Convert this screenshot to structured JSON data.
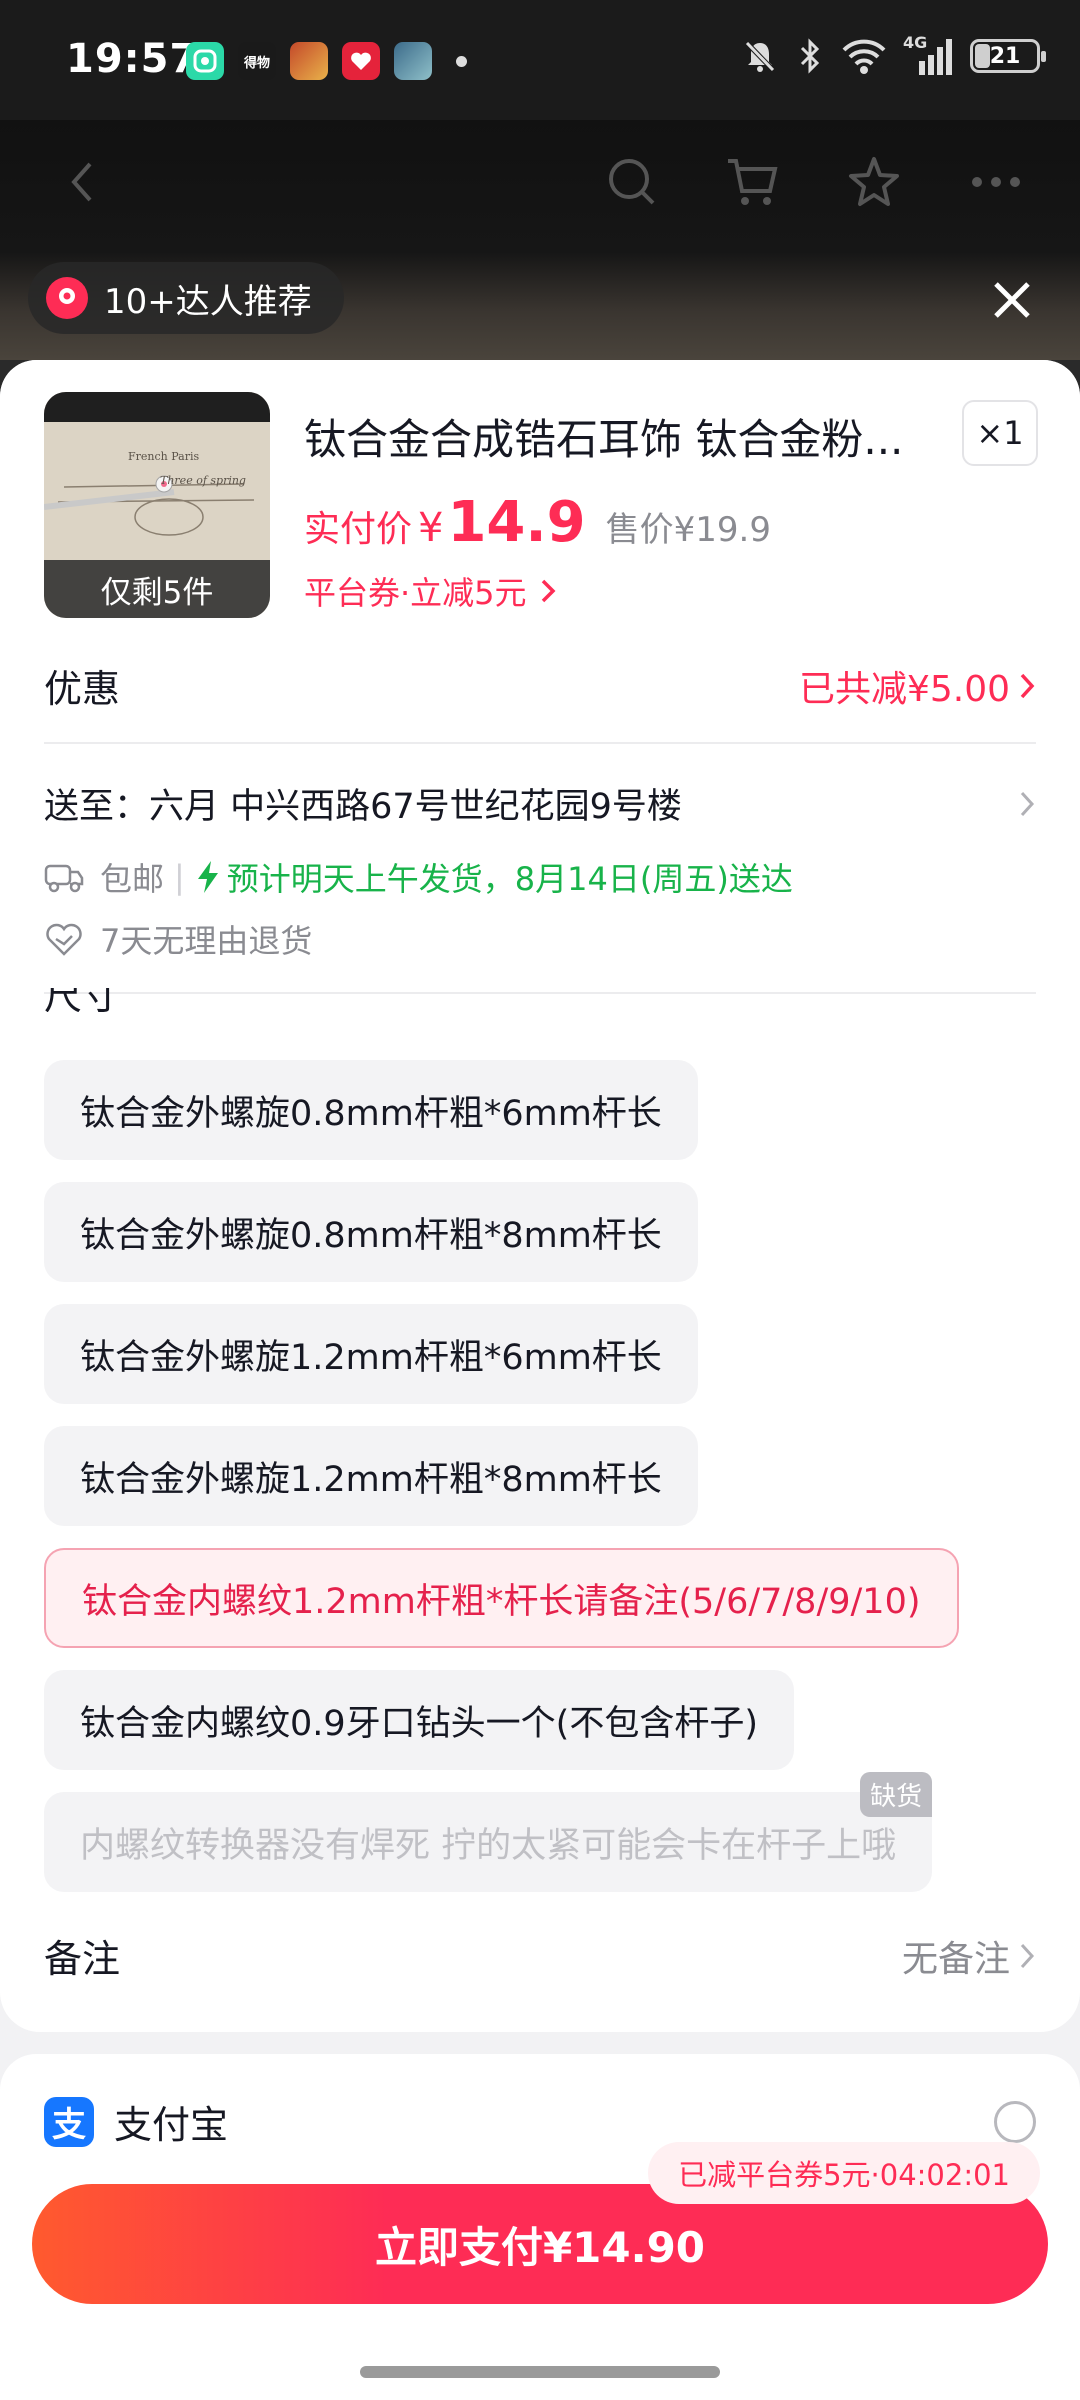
{
  "status_bar": {
    "time": "19:57",
    "app_icon_1": "App",
    "app_icon_2": "得物",
    "network": "4G",
    "battery": "21"
  },
  "header": {
    "recommend_text": "10+达人推荐"
  },
  "product": {
    "title": "钛合金合成锆石耳饰 钛合金粉...",
    "stock_tag": "仅剩5件",
    "thumb_caption_1": "French Paris",
    "thumb_caption_2": "Three of spring",
    "quantity": "×1",
    "price_label": "实付价",
    "price_yen": "¥",
    "price": "14.9",
    "original_price": "售价¥19.9",
    "coupon": "平台券·立减5元"
  },
  "discount": {
    "label": "优惠",
    "value": "已共减¥5.00"
  },
  "address": {
    "text": "送至：六月  中兴西路67号世纪花园9号楼"
  },
  "shipping": {
    "free_shipping": "包邮",
    "separator": "|",
    "eta": "预计明天上午发货，8月14日(周五)送达",
    "returns": "7天无理由退货"
  },
  "size_section": {
    "label": "尺寸",
    "options": [
      {
        "label": "钛合金外螺旋0.8mm杆粗*6mm杆长"
      },
      {
        "label": "钛合金外螺旋0.8mm杆粗*8mm杆长"
      },
      {
        "label": "钛合金外螺旋1.2mm杆粗*6mm杆长"
      },
      {
        "label": "钛合金外螺旋1.2mm杆粗*8mm杆长"
      },
      {
        "label": "钛合金内螺纹1.2mm杆粗*杆长请备注(5/6/7/8/9/10)"
      },
      {
        "label": "钛合金内螺纹0.9牙口钻头一个(不包含杆子)"
      },
      {
        "label": "内螺纹转换器没有焊死 拧的太紧可能会卡在杆子上哦",
        "badge": "缺货"
      }
    ]
  },
  "remark": {
    "label": "备注",
    "value": "无备注"
  },
  "payment": {
    "method": "支付宝",
    "logo_char": "支"
  },
  "footer": {
    "timer_tip": "已减平台券5元·04:02:01",
    "pay_button": "立即支付¥14.90"
  },
  "colors": {
    "accent": "#fe2c55",
    "green": "#18b34a",
    "alipay_blue": "#1677ff"
  }
}
